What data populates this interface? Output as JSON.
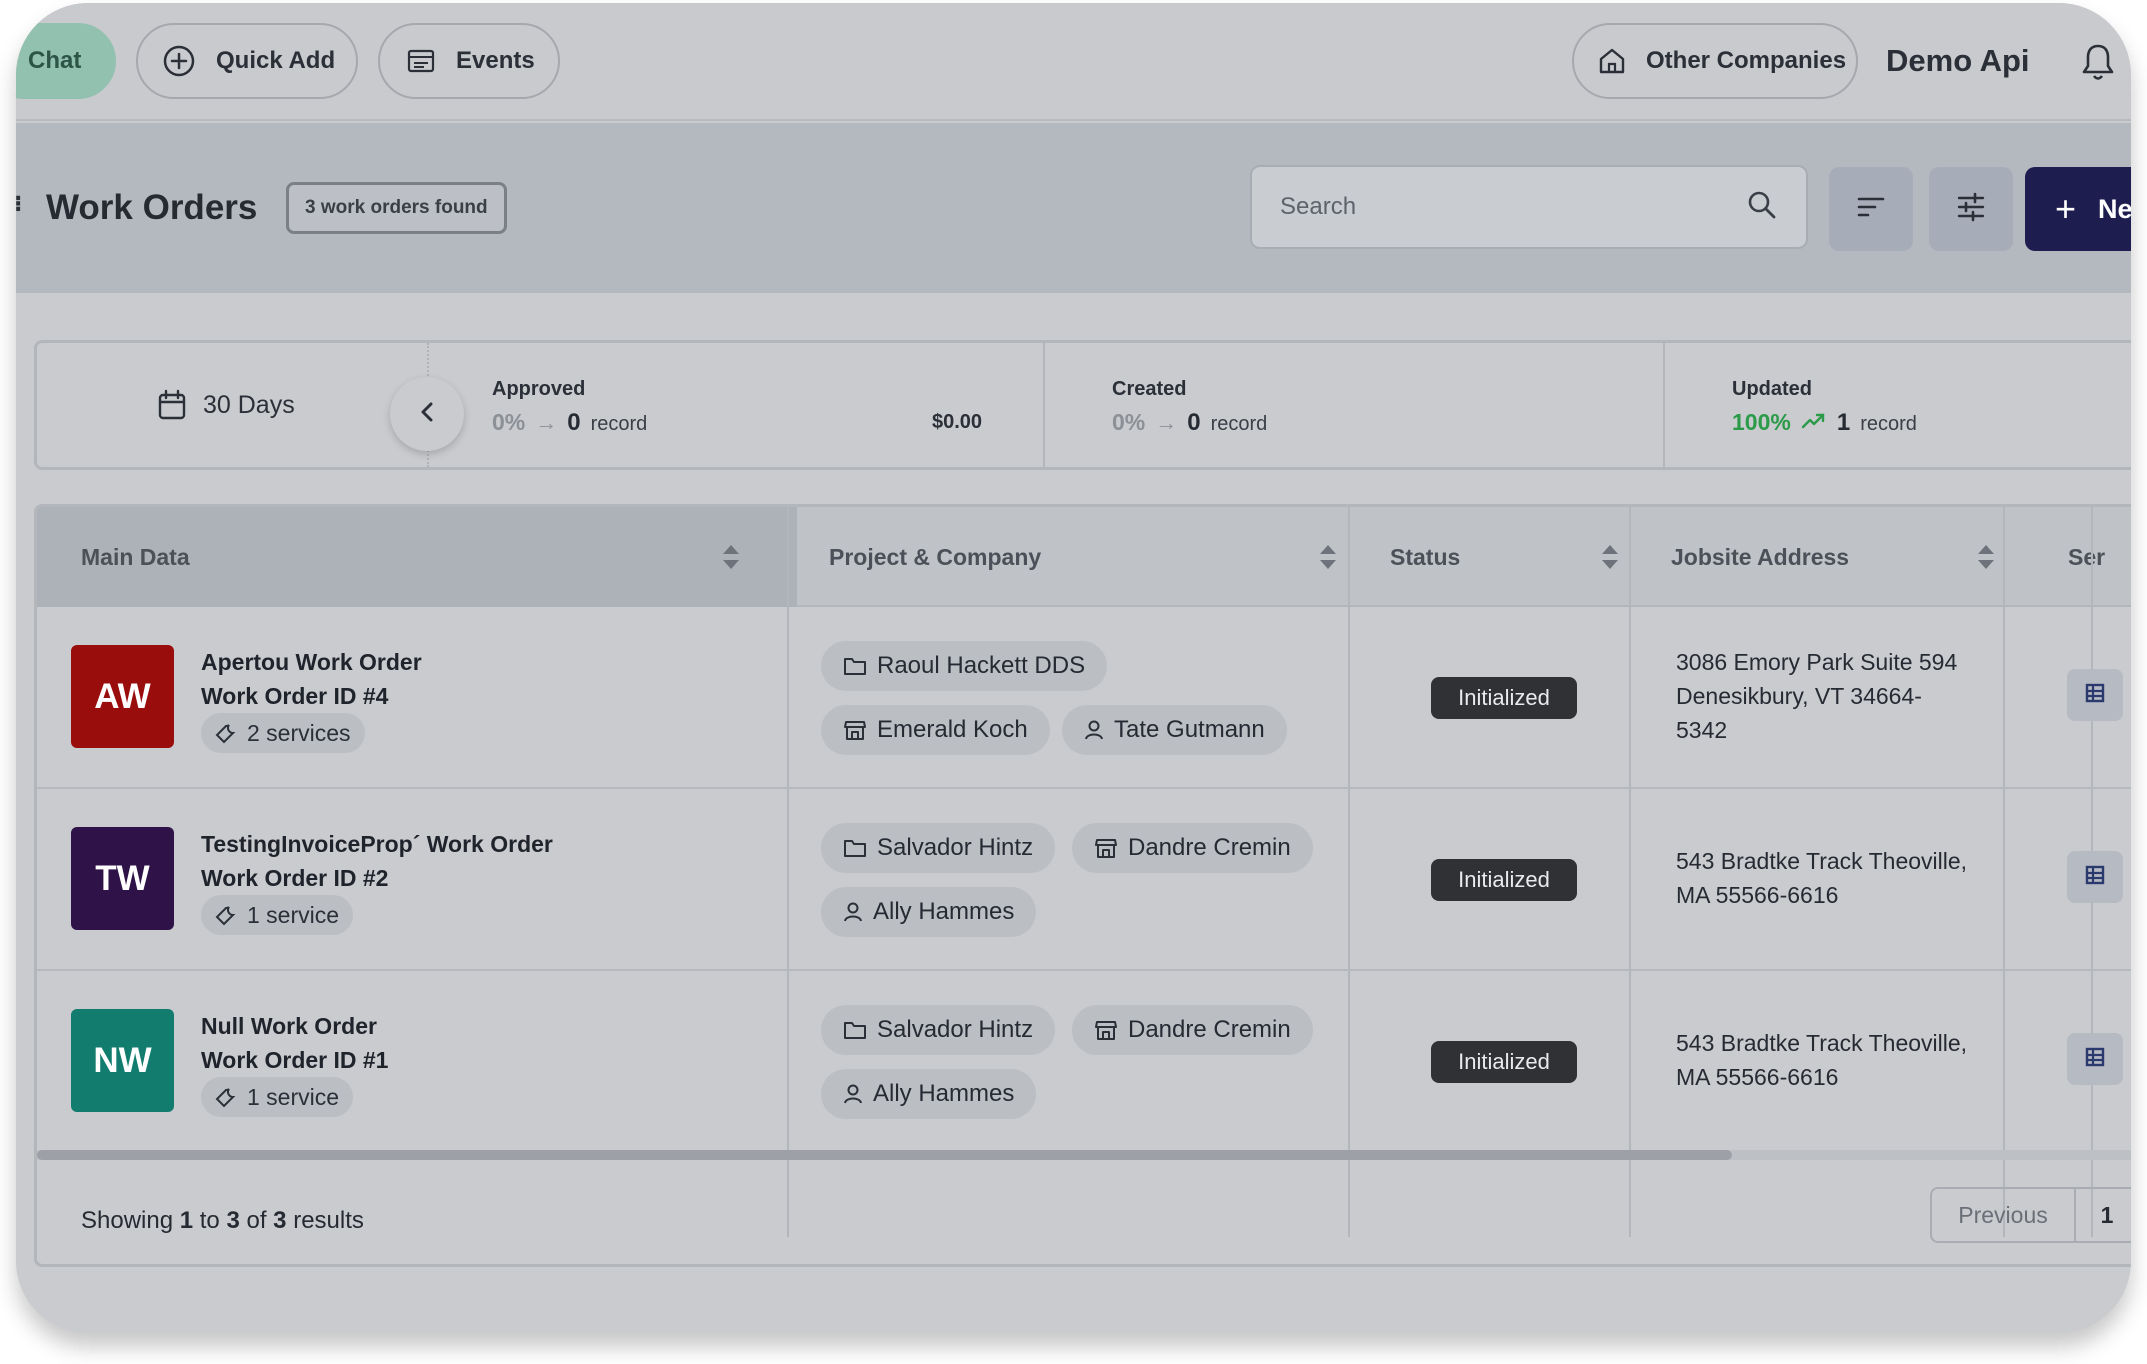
{
  "topbar": {
    "chat_label": "Chat",
    "quick_add_label": "Quick Add",
    "events_label": "Events",
    "other_companies_label": "Other Companies",
    "account_name": "Demo Api"
  },
  "header": {
    "title": "Work Orders",
    "count_badge": "3 work orders found",
    "search_placeholder": "Search",
    "new_button_label": "Ne"
  },
  "stats": {
    "period": "30 Days",
    "approved": {
      "label": "Approved",
      "percent": "0%",
      "arrow": "→",
      "count": "0",
      "unit": "record",
      "amount": "$0.00"
    },
    "created": {
      "label": "Created",
      "percent": "0%",
      "arrow": "→",
      "count": "0",
      "unit": "record"
    },
    "updated": {
      "label": "Updated",
      "percent": "100%",
      "count": "1",
      "unit": "record"
    }
  },
  "table": {
    "columns": [
      "Main Data",
      "Project & Company",
      "Status",
      "Jobsite Address",
      "Ser"
    ],
    "rows": [
      {
        "initials": "AW",
        "avatar_color": "#9a0d0d",
        "name": "Apertou Work Order",
        "order_id": "Work Order ID #4",
        "services": "2 services",
        "project": "Raoul Hackett DDS",
        "company": "Emerald Koch",
        "contact": "Tate Gutmann",
        "status": "Initialized",
        "address_line1": "3086 Emory Park Suite 594",
        "address_line2": "Denesikbury, VT 34664-",
        "address_line3": "5342"
      },
      {
        "initials": "TW",
        "avatar_color": "#2e1248",
        "name": "TestingInvoiceProp´ Work Order",
        "order_id": "Work Order ID #2",
        "services": "1 service",
        "project": "Salvador Hintz",
        "company": "Dandre Cremin",
        "contact": "Ally Hammes",
        "status": "Initialized",
        "address_line1": "543 Bradtke Track Theoville,",
        "address_line2": "MA 55566-6616"
      },
      {
        "initials": "NW",
        "avatar_color": "#127d6e",
        "name": "Null Work Order",
        "order_id": "Work Order ID #1",
        "services": "1 service",
        "project": "Salvador Hintz",
        "company": "Dandre Cremin",
        "contact": "Ally Hammes",
        "status": "Initialized",
        "address_line1": "543 Bradtke Track Theoville,",
        "address_line2": "MA 55566-6616"
      }
    ]
  },
  "footer": {
    "showing": "Showing",
    "from": "1",
    "to_word": "to",
    "to": "3",
    "of_word": "of",
    "total": "3",
    "results_word": "results",
    "previous_label": "Previous",
    "current_page": "1"
  },
  "colors": {
    "brand_dark": "#1e1d4f",
    "chat_green": "#93c1b0",
    "positive": "#2c9b49",
    "status_bg": "#2f3134"
  },
  "icons": [
    "plus-circle-icon",
    "events-icon",
    "home-icon",
    "bell-icon",
    "search-icon",
    "sort-icon",
    "sliders-icon",
    "calendar-icon",
    "chevron-left-icon",
    "folder-icon",
    "store-icon",
    "user-icon",
    "wrench-icon",
    "table-icon",
    "trend-up-icon"
  ]
}
